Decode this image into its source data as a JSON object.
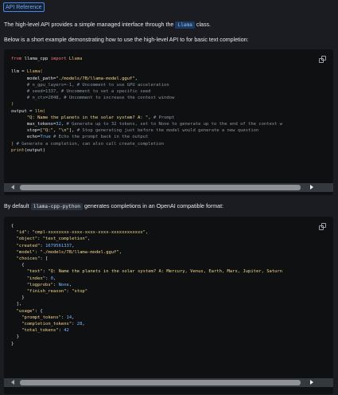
{
  "header": {
    "link_text": "API Reference"
  },
  "intro": {
    "line1_before": "The high-level API provides a simple managed interface through the",
    "line1_code": "Llama",
    "line1_after": "class.",
    "line2": "Below is a short example demonstrating how to use the high-level API to for basic text completion:"
  },
  "code_block_1": {
    "lines": [
      [
        [
          "kw",
          "from "
        ],
        [
          "name",
          "llama_cpp "
        ],
        [
          "kw",
          "import "
        ],
        [
          "fn",
          "Llama"
        ]
      ],
      [],
      [
        [
          "name",
          "llm = "
        ],
        [
          "fn",
          "Llama("
        ]
      ],
      [
        [
          "name",
          "      model_path="
        ],
        [
          "str",
          "\"./models/7B/llama-model.gguf\""
        ],
        [
          "name",
          ","
        ]
      ],
      [
        [
          "com",
          "      # n_gpu_layers=-1, # Uncomment to use GPU acceleration"
        ]
      ],
      [
        [
          "com",
          "      # seed=1337, # Uncomment to set a specific seed"
        ]
      ],
      [
        [
          "com",
          "      # n_ctx=2048, # Uncomment to increase the context window"
        ]
      ],
      [
        [
          "fn",
          ")"
        ]
      ],
      [
        [
          "name",
          "output = "
        ],
        [
          "fn",
          "llm("
        ]
      ],
      [
        [
          "name",
          "      "
        ],
        [
          "str",
          "\"Q: Name the planets in the solar system? A: \""
        ],
        [
          "name",
          ", "
        ],
        [
          "com",
          "# Prompt"
        ]
      ],
      [
        [
          "name",
          "      max_tokens="
        ],
        [
          "num",
          "32"
        ],
        [
          "name",
          ", "
        ],
        [
          "com",
          "# Generate up to 32 tokens, set to None to generate up to the end of the context w"
        ]
      ],
      [
        [
          "name",
          "      stop=["
        ],
        [
          "str",
          "\"Q:\""
        ],
        [
          "name",
          ", "
        ],
        [
          "str",
          "\"\\n\""
        ],
        [
          "name",
          "], "
        ],
        [
          "com",
          "# Stop generating just before the model would generate a new question"
        ]
      ],
      [
        [
          "name",
          "      echo="
        ],
        [
          "num",
          "True"
        ],
        [
          "name",
          " "
        ],
        [
          "com",
          "# Echo the prompt back in the output"
        ]
      ],
      [
        [
          "fn",
          ")"
        ],
        [
          "name",
          " "
        ],
        [
          "com",
          "# Generate a completion, can also call create_completion"
        ]
      ],
      [
        [
          "fn",
          "print"
        ],
        [
          "name",
          "(output)"
        ]
      ]
    ]
  },
  "between": {
    "before": "By default",
    "code": "llama-cpp-python",
    "after": "generates completions in an OpenAI compatible format:"
  },
  "code_block_2": {
    "lines": [
      [
        [
          "name",
          "{"
        ]
      ],
      [
        [
          "name",
          "  "
        ],
        [
          "str",
          "\"id\""
        ],
        [
          "name",
          ": "
        ],
        [
          "str",
          "\"cmpl-xxxxxxxx-xxxx-xxxx-xxxx-xxxxxxxxxxxx\""
        ],
        [
          "name",
          ","
        ]
      ],
      [
        [
          "name",
          "  "
        ],
        [
          "str",
          "\"object\""
        ],
        [
          "name",
          ": "
        ],
        [
          "str",
          "\"text_completion\""
        ],
        [
          "name",
          ","
        ]
      ],
      [
        [
          "name",
          "  "
        ],
        [
          "str",
          "\"created\""
        ],
        [
          "name",
          ": "
        ],
        [
          "num",
          "1679561337"
        ],
        [
          "name",
          ","
        ]
      ],
      [
        [
          "name",
          "  "
        ],
        [
          "str",
          "\"model\""
        ],
        [
          "name",
          ": "
        ],
        [
          "str",
          "\"./models/7B/llama-model.gguf\""
        ],
        [
          "name",
          ","
        ]
      ],
      [
        [
          "name",
          "  "
        ],
        [
          "str",
          "\"choices\""
        ],
        [
          "name",
          ": ["
        ]
      ],
      [
        [
          "name",
          "    {"
        ]
      ],
      [
        [
          "name",
          "      "
        ],
        [
          "str",
          "\"text\""
        ],
        [
          "name",
          ": "
        ],
        [
          "str",
          "\"Q: Name the planets in the solar system? A: Mercury, Venus, Earth, Mars, Jupiter, Saturn"
        ]
      ],
      [
        [
          "name",
          "      "
        ],
        [
          "str",
          "\"index\""
        ],
        [
          "name",
          ": "
        ],
        [
          "num",
          "0"
        ],
        [
          "name",
          ","
        ]
      ],
      [
        [
          "name",
          "      "
        ],
        [
          "str",
          "\"logprobs\""
        ],
        [
          "name",
          ": "
        ],
        [
          "num",
          "None"
        ],
        [
          "name",
          ","
        ]
      ],
      [
        [
          "name",
          "      "
        ],
        [
          "str",
          "\"finish_reason\""
        ],
        [
          "name",
          ": "
        ],
        [
          "str",
          "\"stop\""
        ]
      ],
      [
        [
          "name",
          "    }"
        ]
      ],
      [
        [
          "name",
          "  ],"
        ]
      ],
      [
        [
          "name",
          "  "
        ],
        [
          "str",
          "\"usage\""
        ],
        [
          "name",
          ": {"
        ]
      ],
      [
        [
          "name",
          "    "
        ],
        [
          "str",
          "\"prompt_tokens\""
        ],
        [
          "name",
          ": "
        ],
        [
          "num",
          "14"
        ],
        [
          "name",
          ","
        ]
      ],
      [
        [
          "name",
          "    "
        ],
        [
          "str",
          "\"completion_tokens\""
        ],
        [
          "name",
          ": "
        ],
        [
          "num",
          "28"
        ],
        [
          "name",
          ","
        ]
      ],
      [
        [
          "name",
          "    "
        ],
        [
          "str",
          "\"total_tokens\""
        ],
        [
          "name",
          ": "
        ],
        [
          "num",
          "42"
        ]
      ],
      [
        [
          "name",
          "  }"
        ]
      ],
      [
        [
          "name",
          "}"
        ]
      ]
    ]
  },
  "icons": {
    "copy": "copy-icon",
    "scroll_left": "arrow-left-icon",
    "scroll_right": "arrow-right-icon"
  },
  "colors": {
    "link": "#6ea8ff",
    "code_bg": "#0f1012",
    "page_bg": "#1a1c21",
    "keyword": "#f97583",
    "string": "#f6d68c",
    "number": "#79b8ff",
    "comment": "#8b949e"
  }
}
